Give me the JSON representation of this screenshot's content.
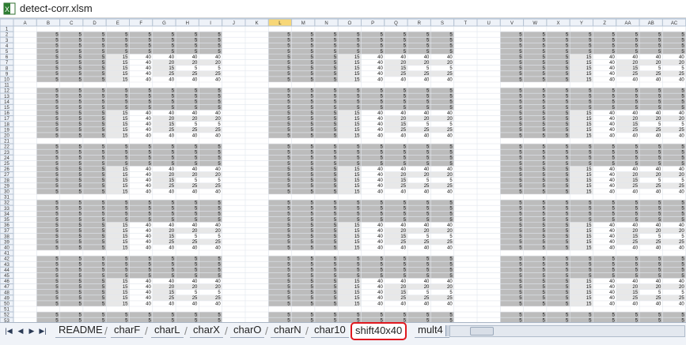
{
  "window": {
    "title": "detect-corr.xlsm"
  },
  "sheet": {
    "columns": [
      "A",
      "B",
      "C",
      "D",
      "E",
      "F",
      "G",
      "H",
      "I",
      "J",
      "K",
      "L",
      "M",
      "N",
      "O",
      "P",
      "Q",
      "R",
      "S",
      "T",
      "U",
      "V",
      "W",
      "X",
      "Y",
      "Z",
      "AA",
      "AB",
      "AC"
    ],
    "selected_column": "L",
    "rows": [
      "1",
      "2",
      "3",
      "4",
      "5",
      "6",
      "7",
      "8",
      "9",
      "10",
      "11",
      "12",
      "13",
      "14",
      "15",
      "16",
      "17",
      "18",
      "19",
      "20",
      "21",
      "22",
      "23",
      "24",
      "25",
      "26",
      "27",
      "28",
      "29",
      "30",
      "31",
      "32",
      "33",
      "34",
      "35",
      "36",
      "37",
      "38",
      "39",
      "40",
      "41",
      "42",
      "43",
      "44",
      "45",
      "46",
      "47",
      "48",
      "49",
      "50",
      "51",
      "52",
      "53"
    ]
  },
  "cells": {
    "pattern_rows": [
      [
        "5",
        "5",
        "5",
        "5",
        "5",
        "5",
        "5",
        "5"
      ],
      [
        "5",
        "5",
        "5",
        "5",
        "5",
        "5",
        "5",
        "5"
      ],
      [
        "5",
        "5",
        "5",
        "5",
        "5",
        "5",
        "5",
        "5"
      ],
      [
        "5",
        "5",
        "5",
        "5",
        "5",
        "5",
        "5",
        "5"
      ],
      [
        "5",
        "5",
        "5",
        "15",
        "40",
        "40",
        "40",
        "40"
      ],
      [
        "5",
        "5",
        "5",
        "15",
        "40",
        "20",
        "20",
        "20"
      ],
      [
        "5",
        "5",
        "5",
        "15",
        "40",
        "15",
        "5",
        "5"
      ],
      [
        "5",
        "5",
        "5",
        "15",
        "40",
        "25",
        "25",
        "25"
      ],
      [
        "5",
        "5",
        "5",
        "15",
        "40",
        "40",
        "40",
        "40"
      ]
    ]
  },
  "tabs": {
    "nav": [
      "first-sheet",
      "prev-sheet",
      "next-sheet",
      "last-sheet"
    ],
    "items": [
      "README",
      "charF",
      "charL",
      "charX",
      "charO",
      "charN",
      "char10",
      "shift40x40",
      "mult4"
    ],
    "active": "shift40x40"
  },
  "colors": {
    "block_fill": "#bcbcbc",
    "light_fill": "#e8e8e8",
    "active_tab_border": "#e0191f",
    "header_selected": "#f7d777"
  }
}
